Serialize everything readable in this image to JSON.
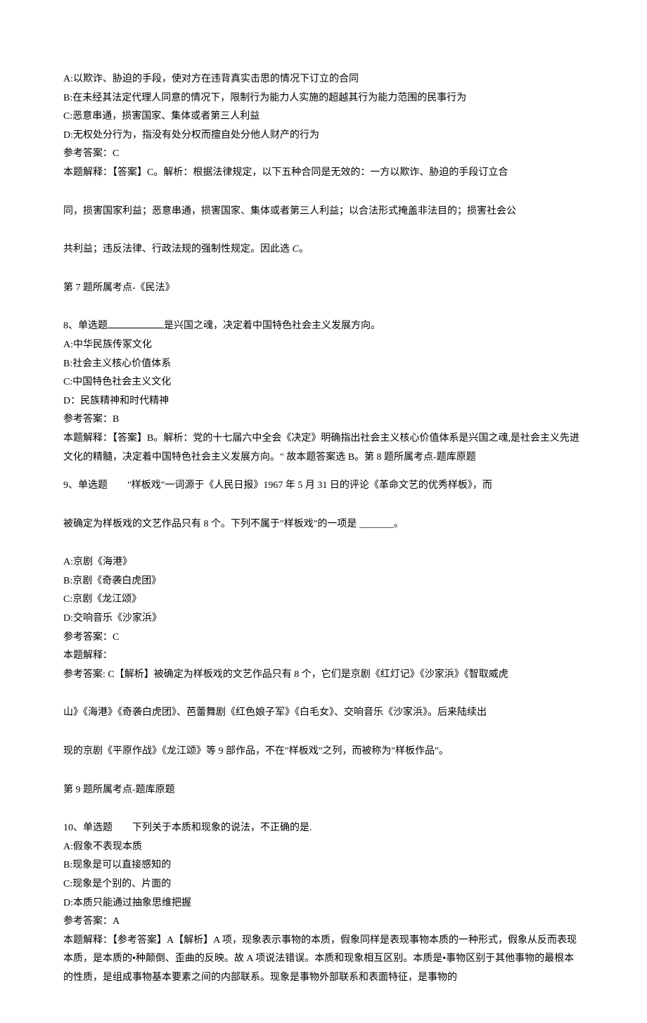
{
  "q7_prefix": {
    "optA": "A:以欺诈、胁迫的手段，使对方在违背真实击思的情况下订立的合同",
    "optB": "B:在未经其法定代理人同意的情况下，限制行为能力人实施的超越其行为能力范围的民事行为",
    "optC": "C:恶意串通，损害国家、集体或者第三人利益",
    "optD": "D:无权处分行为，指没有处分权而擅自处分他人财产的行为",
    "ansLabel": "参考答案：C",
    "explain1": "本题解释：【答案】C。解析：根据法律规定，以下五种合同是无效的：一方以欺诈、胁迫的手段订立合",
    "explain2": "同，损害国家利益；恶意串通，损害国家、集体或者第三人利益；以合法形式掩盖非法目的；损害社会公",
    "explain3_a": "共利益；违反法律、行政法规的强制性规定。因此选 ",
    "explain3_b": "C",
    "explain3_c": "。",
    "topic": "第 7 题所属考点-《民法》"
  },
  "q8": {
    "stem_a": "8、单选题",
    "stem_b": "是兴国之魂，决定着中国特色社会主义发展方向。",
    "optA": "A:中华民族传冢文化",
    "optB": "B:社会主义核心价值体系",
    "optC": "C:中国特色社会主义文化",
    "optD": "D：民族精神和时代精神",
    "ansLabel": "参考答案：B",
    "explain1": "本题解释：【答案】B。解析：党的十七届六中全会《决定》明确指出社会主义核心价值体系是兴国之魂,是社会主义先进文化的精髓，决定着中国特色社会主义发展方向。\" 故本题答案选 B。第 8 题所属考点-题库原题"
  },
  "q9": {
    "stem1": "9、单选题　　\"样板戏\"一词源于《人民日报》1967 年 5 月 31 日的评论《革命文艺的优秀样板》，而",
    "stem2": "被确定为样板戏的文艺作品只有 8 个。下列不属于\"样板戏\"的一项是 _______。",
    "optA": "A:京剧《海港》",
    "optB": "B:京剧《奇袭白虎团》",
    "optC": "C:京剧《龙江颂》",
    "optD": "D:交响音乐《沙家浜》",
    "ansLabel": "参考答案：C",
    "explainLabel": "本题解释：",
    "explain1": "参考答案: C【解析】被确定为样板戏的文艺作品只有 8 个，它们是京剧《红灯记》《沙家浜》《智取威虎",
    "explain2": "山》《海港》《奇袭白虎团》、芭蕾舞剧《红色娘子军》《白毛女》、交响音乐《沙家浜》。后来陆续出",
    "explain3": "现的京剧《平原作战》《龙江颂》等 9 部作品，不在\"样板戏\"之列，而被称为\"样板作品\"。",
    "topic": "第 9 题所属考点-题库原题"
  },
  "q10": {
    "stem": "10、单选题　　下列关于本质和现象的说法，不正确的是.",
    "optA": "A:假象不表现本质",
    "optB": "B:现象是可以直接感知的",
    "optC": "C:现象是个别的、片面的",
    "optD": "D:本质只能通过抽象思维把握",
    "ansLabel": "参考答案：A",
    "explain1": "本题解释：【参考答案】A【解析】A 项，现象表示事物的本质，假象同样是表现事物本质的一种形式，假象从反而表现本质，是本质的•种颠倒、歪曲的反映。故 A 项说法错误。本质和现象相互区别。本质是•事物区别于其他事物的最根本的性质，是组成事物基本要素之间的内部联系。现象是事物外部联系和表面特征，是事物的"
  }
}
